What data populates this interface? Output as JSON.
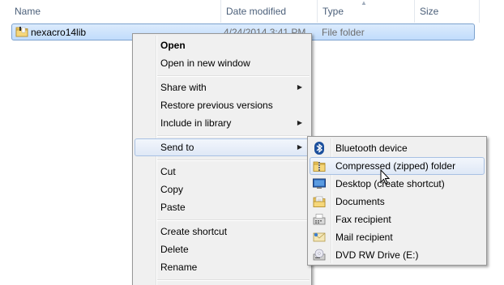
{
  "columns": {
    "name": "Name",
    "date_modified": "Date modified",
    "type": "Type",
    "size": "Size"
  },
  "file": {
    "name": "nexacro14lib",
    "date": "4/24/2014 3:41 PM...",
    "type": "File folder",
    "icon": "folder-icon"
  },
  "context_menu": {
    "open": "Open",
    "open_new_window": "Open in new window",
    "share_with": "Share with",
    "restore_previous": "Restore previous versions",
    "include_in_library": "Include in library",
    "send_to": "Send to",
    "cut": "Cut",
    "copy": "Copy",
    "paste": "Paste",
    "create_shortcut": "Create shortcut",
    "delete": "Delete",
    "rename": "Rename"
  },
  "send_to_menu": {
    "items": [
      {
        "label": "Bluetooth device",
        "icon": "bluetooth-icon"
      },
      {
        "label": "Compressed (zipped) folder",
        "icon": "zip-folder-icon"
      },
      {
        "label": "Desktop (create shortcut)",
        "icon": "desktop-icon"
      },
      {
        "label": "Documents",
        "icon": "documents-icon"
      },
      {
        "label": "Fax recipient",
        "icon": "fax-icon"
      },
      {
        "label": "Mail recipient",
        "icon": "mail-icon"
      },
      {
        "label": "DVD RW Drive (E:)",
        "icon": "dvd-drive-icon"
      }
    ]
  },
  "colors": {
    "selection": "#c1dcfc",
    "menu_bg": "#f0f0f0",
    "header_text": "#4c607a"
  }
}
